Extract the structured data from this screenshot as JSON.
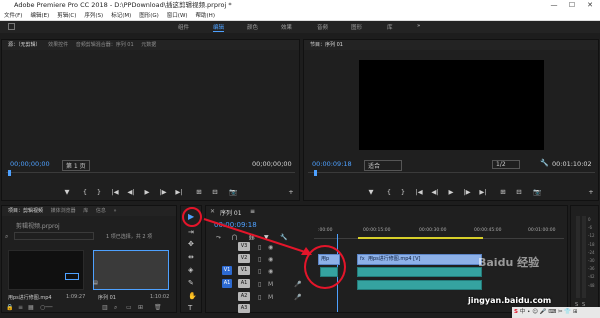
{
  "titlebar": {
    "app_icon": "Pr",
    "title": "Adobe Premiere Pro CC 2018 - D:\\PPDownload\\插这剪辑视频.prproj *",
    "minimize": "—",
    "maximize": "☐",
    "close": "✕"
  },
  "menu": [
    "文件(F)",
    "编辑(E)",
    "剪辑(C)",
    "序列(S)",
    "标记(M)",
    "图形(G)",
    "窗口(W)",
    "帮助(H)"
  ],
  "workspace": {
    "tabs": [
      "组件",
      "编辑",
      "颜色",
      "效果",
      "音频",
      "图形",
      "库"
    ],
    "active": "编辑",
    "more": "»"
  },
  "source_panel": {
    "tabs": [
      "源：（无剪辑）",
      "效果控件",
      "音频剪辑混合器：序列 01",
      "元数据"
    ],
    "timecode_left": "00;00;00;00",
    "page_select": "第 1 页",
    "timecode_right": "00;00;00;00",
    "controls": [
      "▼",
      "{",
      "}",
      "|◀",
      "◀|",
      "▶",
      "|▶",
      "▶|",
      "⊞",
      "⊟",
      "📷",
      "+"
    ]
  },
  "program_panel": {
    "tab": "节目：序列 01",
    "timecode_left": "00:00:09:18",
    "fit": "适合",
    "ratio": "1/2",
    "timecode_right": "00:01:10:02",
    "controls": [
      "▼",
      "{",
      "}",
      "|◀",
      "◀|",
      "▶",
      "|▶",
      "▶|",
      "⊞",
      "⊟",
      "📷",
      "+"
    ]
  },
  "project_panel": {
    "tabs": [
      "项目：剪辑视频",
      "媒体浏览器",
      "库",
      "信息"
    ],
    "more": "»",
    "project_file": "剪辑视频.prproj",
    "selection_info": "1 项已选择，共 2 项",
    "items": [
      {
        "name": "用ps进行修图.mp4",
        "duration": "1:09:27"
      },
      {
        "name": "序列 01",
        "duration": "1:10:02"
      }
    ]
  },
  "tools": [
    "▶",
    "⇥",
    "✥",
    "⇹",
    "◈",
    "✎",
    "✋",
    "T"
  ],
  "timeline": {
    "tab": "序列 01",
    "tab_menu": "≡",
    "timecode": "00:00:09:18",
    "ruler": [
      ":00:00",
      "00:00:15:00",
      "00:00:30:00",
      "00:00:45:00",
      "00:01:00:00"
    ],
    "video_tracks": [
      "V3",
      "V2",
      "V1"
    ],
    "audio_tracks": [
      "A1",
      "A2",
      "A3"
    ],
    "video_clip": "用ps进行修图.mp4 [V]",
    "fx_label": "fx",
    "clip_marker": "用p"
  },
  "meter": {
    "labels": [
      "0",
      "-6",
      "-12",
      "-18",
      "-24",
      "-30",
      "-36",
      "-42",
      "-48",
      "S",
      "S"
    ]
  },
  "watermark": {
    "brand": "Baidu 经验",
    "url": "jingyan.baidu.com",
    "tray": [
      "S",
      "中",
      "∙",
      "☺",
      "🎤",
      "⌨",
      "✂",
      "👕",
      "⊞"
    ]
  },
  "colors": {
    "accent": "#4ea1ff",
    "annotation_red": "#e4152a",
    "video_clip": "#8db1e8",
    "audio_clip": "#35a3a0"
  }
}
